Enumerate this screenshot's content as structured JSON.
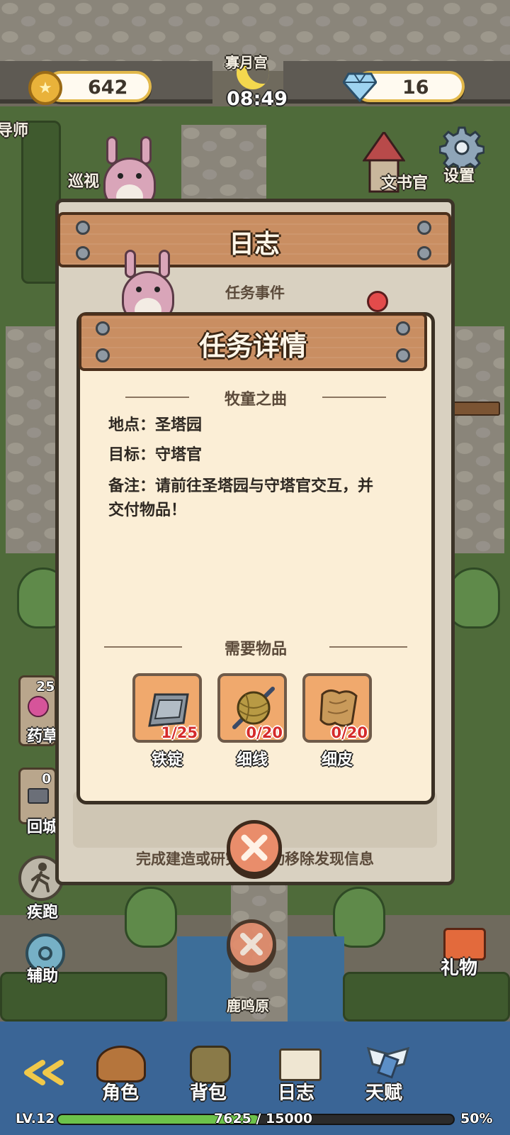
{
  "hud": {
    "coins": "642",
    "gems": "16",
    "time": "08:49",
    "settings_label": "设置"
  },
  "map_labels": {
    "top_location": "寡月宫",
    "mentor": "导师",
    "patrol": "巡视",
    "scribe": "文书官",
    "bottom_location": "鹿鸣原"
  },
  "side_buttons": {
    "herb_count": "25",
    "herb_label": "药草",
    "return_count": "0",
    "return_label": "回城",
    "sprint_label": "疾跑",
    "assist_label": "辅助",
    "gift_label": "礼物"
  },
  "journal": {
    "title": "日志",
    "section_label": "任务事件",
    "footer_hint": "完成建造或研究后自动移除发现信息"
  },
  "task": {
    "title": "任务详情",
    "quest_name": "牧童之曲",
    "location_line": "地点：圣塔园",
    "target_line": "目标：守塔官",
    "note_line1": "备注：请前往圣塔园与守塔官交互，并",
    "note_line2": "交付物品！",
    "items_header": "需要物品",
    "items": [
      {
        "name": "铁锭",
        "count": "1/25",
        "icon": "iron-ingot-icon"
      },
      {
        "name": "细线",
        "count": "0/20",
        "icon": "yarn-ball-icon"
      },
      {
        "name": "细皮",
        "count": "0/20",
        "icon": "leather-scroll-icon"
      }
    ]
  },
  "nav": {
    "character": "角色",
    "backpack": "背包",
    "journal": "日志",
    "talent": "天赋"
  },
  "player": {
    "level": "LV.12",
    "xp_text": "7625 / 15000",
    "xp_percent": "50%",
    "xp_fraction": 0.508
  }
}
